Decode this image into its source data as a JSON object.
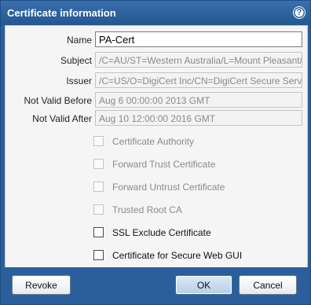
{
  "dialog": {
    "title": "Certificate information",
    "help_icon": "question-mark-icon",
    "help_glyph": "?"
  },
  "fields": {
    "name": {
      "label": "Name",
      "value": "PA-Cert"
    },
    "subject": {
      "label": "Subject",
      "value": "/C=AU/ST=Western Australia/L=Mount Pleasant/O=C"
    },
    "issuer": {
      "label": "Issuer",
      "value": "/C=US/O=DigiCert Inc/CN=DigiCert Secure Server CA"
    },
    "not_valid_before": {
      "label": "Not Valid Before",
      "value": "Aug  6 00:00:00 2013 GMT"
    },
    "not_valid_after": {
      "label": "Not Valid After",
      "value": "Aug 10 12:00:00 2016 GMT"
    }
  },
  "checkboxes": [
    {
      "label": "Certificate Authority",
      "checked": false,
      "enabled": false
    },
    {
      "label": "Forward Trust Certificate",
      "checked": false,
      "enabled": false
    },
    {
      "label": "Forward Untrust Certificate",
      "checked": false,
      "enabled": false
    },
    {
      "label": "Trusted Root CA",
      "checked": false,
      "enabled": false
    },
    {
      "label": "SSL Exclude Certificate",
      "checked": false,
      "enabled": true
    },
    {
      "label": "Certificate for Secure Web GUI",
      "checked": false,
      "enabled": true
    }
  ],
  "buttons": {
    "revoke": "Revoke",
    "ok": "OK",
    "cancel": "Cancel"
  },
  "colors": {
    "title_bar": "#2b5f9b",
    "body_background": "#f5f5f5",
    "disabled_text": "#8a8a8a"
  }
}
